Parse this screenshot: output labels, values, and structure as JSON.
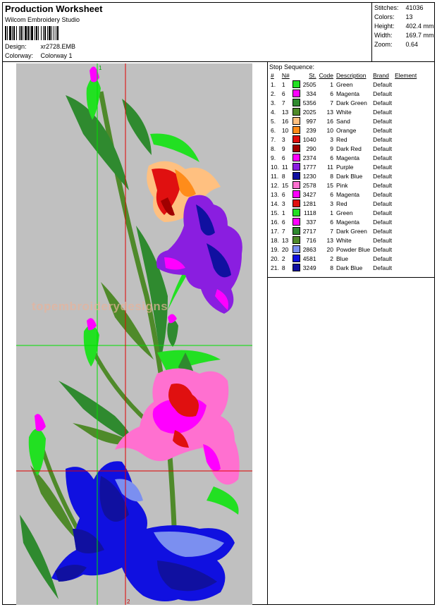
{
  "header": {
    "title": "Production Worksheet",
    "subtitle": "Wilcom Embroidery Studio",
    "design_label": "Design:",
    "design_value": "xr2728.EMB",
    "colorway_label": "Colorway:",
    "colorway_value": "Colorway 1"
  },
  "stats": [
    {
      "label": "Stitches:",
      "value": "41036"
    },
    {
      "label": "Colors:",
      "value": "13"
    },
    {
      "label": "Height:",
      "value": "402.4 mm"
    },
    {
      "label": "Width:",
      "value": "169.7 mm"
    },
    {
      "label": "Zoom:",
      "value": "0.64"
    }
  ],
  "watermark": "topembroiderydesigns",
  "guide_labels": {
    "top": "1",
    "bottom": "2"
  },
  "sequence": {
    "title": "Stop Sequence:",
    "columns": [
      "#",
      "N#",
      "St.",
      "Code",
      "Description",
      "Brand",
      "Element"
    ],
    "rows": [
      {
        "idx": "1.",
        "n": "1",
        "color": "#22e022",
        "st": "2505",
        "code": "1",
        "desc": "Green",
        "brand": "Default"
      },
      {
        "idx": "2.",
        "n": "6",
        "color": "#ff00ff",
        "st": "334",
        "code": "6",
        "desc": "Magenta",
        "brand": "Default"
      },
      {
        "idx": "3.",
        "n": "7",
        "color": "#2f8a2f",
        "st": "5356",
        "code": "7",
        "desc": "Dark Green",
        "brand": "Default"
      },
      {
        "idx": "4.",
        "n": "13",
        "color": "#4f8a2a",
        "st": "2025",
        "code": "13",
        "desc": "White",
        "brand": "Default"
      },
      {
        "idx": "5.",
        "n": "16",
        "color": "#ffc080",
        "st": "997",
        "code": "16",
        "desc": "Sand",
        "brand": "Default"
      },
      {
        "idx": "6.",
        "n": "10",
        "color": "#ff8c1a",
        "st": "239",
        "code": "10",
        "desc": "Orange",
        "brand": "Default"
      },
      {
        "idx": "7.",
        "n": "3",
        "color": "#e01010",
        "st": "1040",
        "code": "3",
        "desc": "Red",
        "brand": "Default"
      },
      {
        "idx": "8.",
        "n": "9",
        "color": "#a00000",
        "st": "290",
        "code": "9",
        "desc": "Dark Red",
        "brand": "Default"
      },
      {
        "idx": "9.",
        "n": "6",
        "color": "#ff00ff",
        "st": "2374",
        "code": "6",
        "desc": "Magenta",
        "brand": "Default"
      },
      {
        "idx": "10.",
        "n": "11",
        "color": "#8a1ee0",
        "st": "1777",
        "code": "11",
        "desc": "Purple",
        "brand": "Default"
      },
      {
        "idx": "11.",
        "n": "8",
        "color": "#1010a0",
        "st": "1230",
        "code": "8",
        "desc": "Dark Blue",
        "brand": "Default"
      },
      {
        "idx": "12.",
        "n": "15",
        "color": "#ff70d0",
        "st": "2578",
        "code": "15",
        "desc": "Pink",
        "brand": "Default"
      },
      {
        "idx": "13.",
        "n": "6",
        "color": "#ff00ff",
        "st": "3427",
        "code": "6",
        "desc": "Magenta",
        "brand": "Default"
      },
      {
        "idx": "14.",
        "n": "3",
        "color": "#e01010",
        "st": "1281",
        "code": "3",
        "desc": "Red",
        "brand": "Default"
      },
      {
        "idx": "15.",
        "n": "1",
        "color": "#22e022",
        "st": "1118",
        "code": "1",
        "desc": "Green",
        "brand": "Default"
      },
      {
        "idx": "16.",
        "n": "6",
        "color": "#ff00ff",
        "st": "337",
        "code": "6",
        "desc": "Magenta",
        "brand": "Default"
      },
      {
        "idx": "17.",
        "n": "7",
        "color": "#2f8a2f",
        "st": "2717",
        "code": "7",
        "desc": "Dark Green",
        "brand": "Default"
      },
      {
        "idx": "18.",
        "n": "13",
        "color": "#4f8a2a",
        "st": "716",
        "code": "13",
        "desc": "White",
        "brand": "Default"
      },
      {
        "idx": "19.",
        "n": "20",
        "color": "#7b8ff0",
        "st": "2863",
        "code": "20",
        "desc": "Powder Blue",
        "brand": "Default"
      },
      {
        "idx": "20.",
        "n": "2",
        "color": "#1010e0",
        "st": "4581",
        "code": "2",
        "desc": "Blue",
        "brand": "Default"
      },
      {
        "idx": "21.",
        "n": "8",
        "color": "#1010a0",
        "st": "3249",
        "code": "8",
        "desc": "Dark Blue",
        "brand": "Default"
      }
    ]
  }
}
